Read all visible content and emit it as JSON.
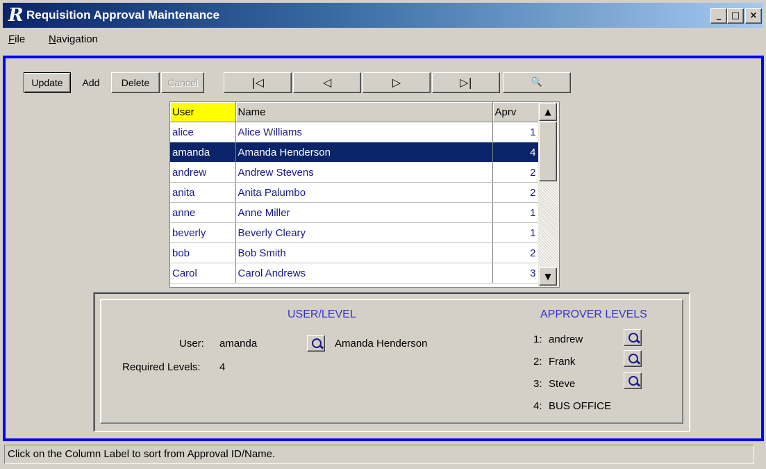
{
  "window": {
    "logo_letter": "R",
    "title": "Requisition Approval Maintenance",
    "minimize_glyph": "_",
    "maximize_glyph": "□",
    "close_glyph": "×"
  },
  "menu": {
    "file": {
      "accel": "F",
      "rest": "ile"
    },
    "navigation": {
      "accel": "N",
      "rest": "avigation"
    }
  },
  "toolbar": {
    "update_label": "Update",
    "add_label": "Add",
    "delete_label": "Delete",
    "cancel_label": "Cancel",
    "first_glyph": "|◁",
    "prev_glyph": "◁",
    "next_glyph": "▷",
    "last_glyph": "▷|",
    "find_glyph": "🔍"
  },
  "grid": {
    "columns": [
      "User",
      "Name",
      "Aprv"
    ],
    "sorted_column": "User",
    "selected_index": 1,
    "rows": [
      {
        "user": "alice",
        "name": "Alice Williams",
        "aprv": "1"
      },
      {
        "user": "amanda",
        "name": "Amanda Henderson",
        "aprv": "4"
      },
      {
        "user": "andrew",
        "name": "Andrew Stevens",
        "aprv": "2"
      },
      {
        "user": "anita",
        "name": "Anita Palumbo",
        "aprv": "2"
      },
      {
        "user": "anne",
        "name": "Anne Miller",
        "aprv": "1"
      },
      {
        "user": "beverly",
        "name": "Beverly Cleary",
        "aprv": "1"
      },
      {
        "user": "bob",
        "name": "Bob Smith",
        "aprv": "2"
      },
      {
        "user": "Carol",
        "name": "Carol Andrews",
        "aprv": "3"
      }
    ],
    "scroll_up_glyph": "▲",
    "scroll_down_glyph": "▼"
  },
  "detail": {
    "user_level_title": "USER/LEVEL",
    "user_label": "User:",
    "user_value": "amanda",
    "user_fullname": "Amanda Henderson",
    "required_label": "Required Levels:",
    "required_value": "4",
    "approver_title": "APPROVER LEVELS",
    "approvers": [
      {
        "level": "1:",
        "name": "andrew"
      },
      {
        "level": "2:",
        "name": "Frank"
      },
      {
        "level": "3:",
        "name": "Steve"
      },
      {
        "level": "4:",
        "name": "BUS OFFICE"
      }
    ]
  },
  "status": {
    "message": "Click on the Column Label to sort from Approval ID/Name."
  },
  "colors": {
    "frame_border": "#0000ff",
    "selection": "#0a246a",
    "sorted_header": "#ffff00",
    "grid_text": "#1a1a8c",
    "section_title": "#3333cc"
  }
}
